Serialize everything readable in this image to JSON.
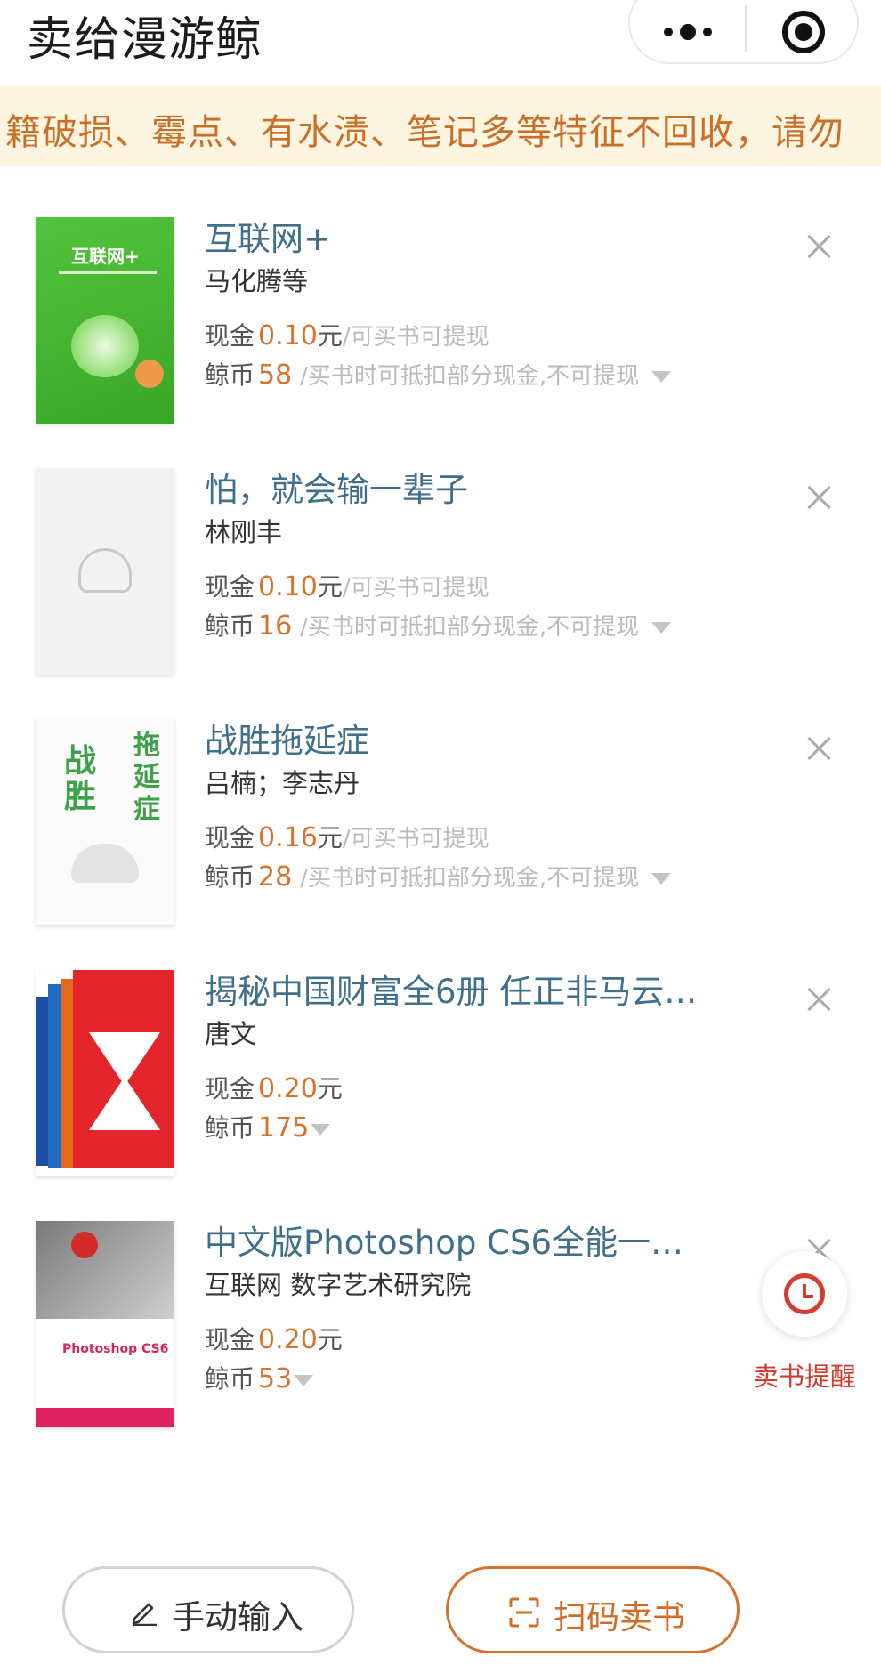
{
  "header": {
    "title": "卖给漫游鲸",
    "more_icon": "more-dots-icon",
    "close_icon": "target-close-icon"
  },
  "notice": {
    "text": "籍破损、霉点、有水渍、笔记多等特征不回收，请勿"
  },
  "labels": {
    "cash": "现金",
    "coin": "鲸币",
    "yuan": "元",
    "cash_hint": "/可买书可提现",
    "coin_hint": "/买书时可抵扣部分现金,不可提现"
  },
  "books": [
    {
      "title": "互联网+",
      "author": "马化腾等",
      "cash": "0.10",
      "coin": "58",
      "show_hints": true
    },
    {
      "title": "怕，就会输一辈子",
      "author": "林刚丰",
      "cash": "0.10",
      "coin": "16",
      "show_hints": true
    },
    {
      "title": "战胜拖延症",
      "author": "吕楠；李志丹",
      "cash": "0.16",
      "coin": "28",
      "show_hints": true
    },
    {
      "title": "揭秘中国财富全6册 任正非马云…",
      "author": "唐文",
      "cash": "0.20",
      "coin": "175",
      "show_hints": false
    },
    {
      "title": "中文版Photoshop CS6全能一…",
      "author": "互联网 数字艺术研究院",
      "cash": "0.20",
      "coin": "53",
      "show_hints": false
    }
  ],
  "covers": {
    "c1_title": "互联网+",
    "c3_a": "战胜",
    "c3_b": "拖延症",
    "c5_ps": "Photoshop CS6"
  },
  "reminder": {
    "label": "卖书提醒",
    "icon": "alarm-clock-icon"
  },
  "actions": {
    "manual": "手动输入",
    "manual_icon": "pencil-icon",
    "scan": "扫码卖书",
    "scan_icon": "scan-icon"
  },
  "colors": {
    "accent": "#d8732d",
    "title_blue": "#3f6f8a",
    "notice_bg": "#fdf5df",
    "reminder_red": "#d33a2e"
  }
}
